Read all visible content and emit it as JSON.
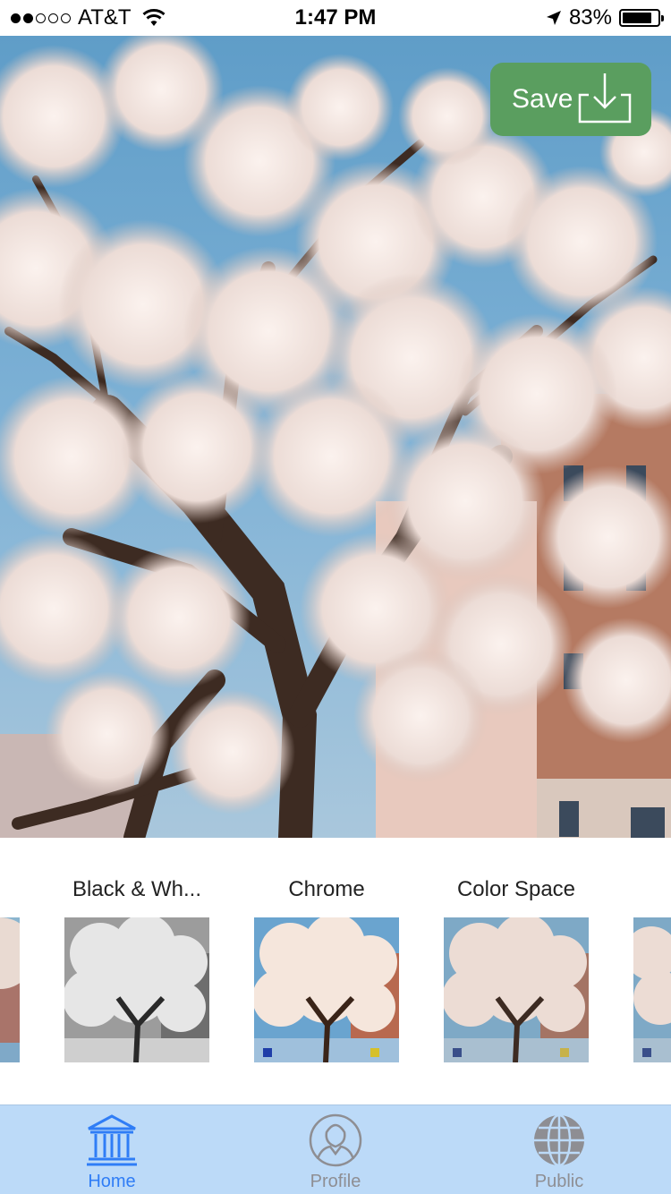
{
  "status_bar": {
    "carrier": "AT&T",
    "time": "1:47 PM",
    "battery_percent": "83%",
    "battery_level": 0.83,
    "signal_bars_filled": 2,
    "signal_bars_total": 5
  },
  "photo": {
    "subject": "cherry-blossom-tree"
  },
  "save_button": {
    "label": "Save",
    "icon": "download-tray-icon",
    "color": "#5a9e5f"
  },
  "filters": {
    "items": [
      {
        "label": "Black & Wh...",
        "style": "grayscale"
      },
      {
        "label": "Chrome",
        "style": "chrome"
      },
      {
        "label": "Color Space",
        "style": "colorspace"
      }
    ]
  },
  "tab_bar": {
    "background": "#bcdaf8",
    "active_color": "#2f7df6",
    "tabs": [
      {
        "label": "Home",
        "icon": "bank-building-icon",
        "active": true
      },
      {
        "label": "Profile",
        "icon": "person-avatar-icon",
        "active": false
      },
      {
        "label": "Public",
        "icon": "globe-icon",
        "active": false
      }
    ]
  }
}
